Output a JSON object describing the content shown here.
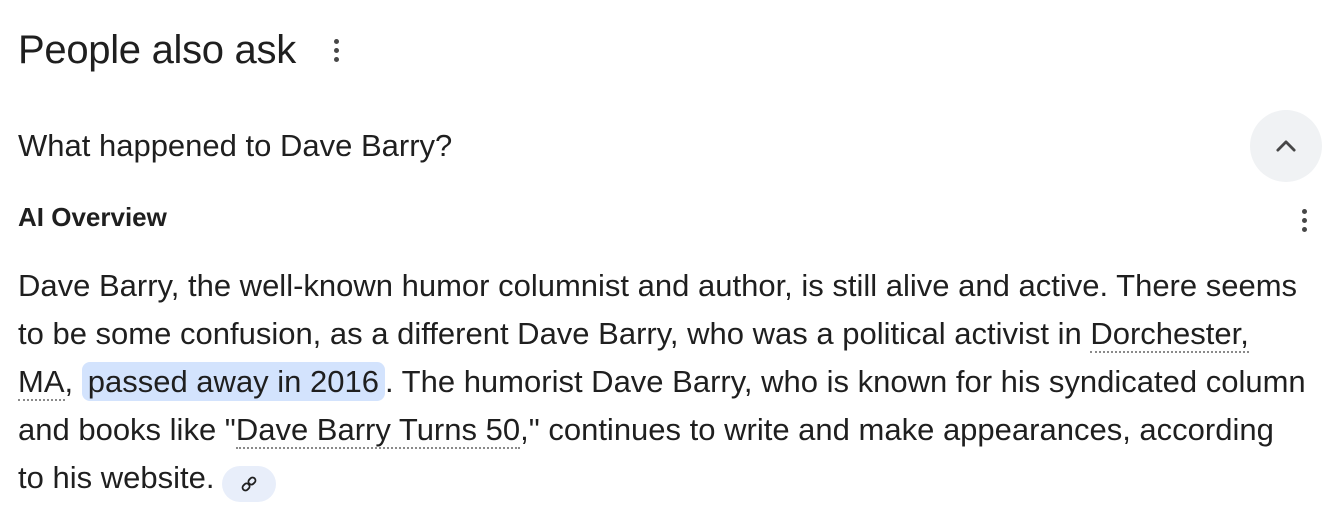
{
  "paa": {
    "title": "People also ask",
    "menu_icon": "more-vert-icon"
  },
  "question": {
    "text": "What happened to Dave Barry?",
    "toggle_icon": "chevron-up-icon"
  },
  "ai_overview": {
    "label": "AI Overview",
    "menu_icon": "more-vert-icon",
    "segments": {
      "s1": "Dave Barry, the well-known humor columnist and author, is still alive and active. There seems to be some confusion, as a different Dave Barry, who was a political activist in ",
      "link1": "Dorchester, MA",
      "s2": ", ",
      "highlight": "passed away in 2016",
      "s3": ". The humorist Dave Barry, who is known for his syndicated column and books like \"",
      "link2": "Dave Barry Turns 50",
      "s4": ",\" continues to write and make appearances, according to his website."
    },
    "source_icon": "link-icon"
  },
  "colors": {
    "text": "#1f1f1f",
    "highlight_bg": "#d3e3fd",
    "chip_bg": "#e8eefa",
    "toggle_bg": "#f0f2f4"
  }
}
